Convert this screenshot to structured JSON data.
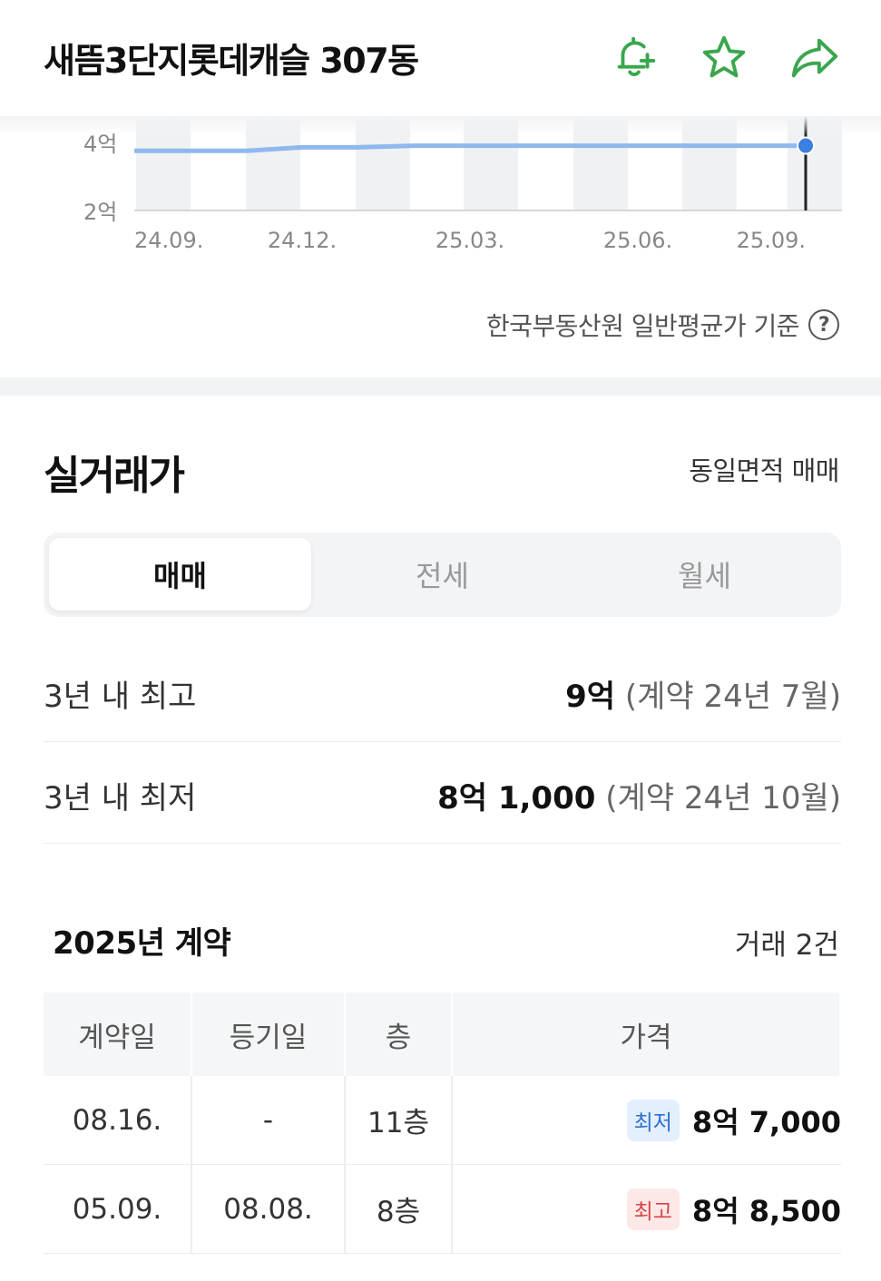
{
  "header": {
    "title": "새뜸3단지롯데캐슬 307동",
    "icon_color": "#3aa64d"
  },
  "chart_data": {
    "type": "line",
    "x": [
      "24.09.",
      "24.10.",
      "24.11.",
      "24.12.",
      "25.01.",
      "25.02.",
      "25.03.",
      "25.04.",
      "25.05.",
      "25.06.",
      "25.07.",
      "25.08.",
      "25.09."
    ],
    "x_tick_labels": [
      "24.09.",
      "24.12.",
      "25.03.",
      "25.06.",
      "25.09."
    ],
    "y_tick_labels": [
      "4억",
      "2억"
    ],
    "series": [
      {
        "values": [
          3.75,
          3.75,
          3.75,
          3.85,
          3.85,
          3.9,
          3.9,
          3.9,
          3.9,
          3.9,
          3.9,
          3.9,
          3.9
        ]
      }
    ],
    "ylim": [
      2,
      4.5
    ],
    "line_color": "#8fb8ee",
    "marker_color": "#3b7fe0",
    "title": "",
    "xlabel": "",
    "ylabel": ""
  },
  "source_note": "한국부동산원 일반평균가 기준",
  "help_symbol": "?",
  "section": {
    "title": "실거래가",
    "link": "동일면적 매매"
  },
  "tabs": [
    "매매",
    "전세",
    "월세"
  ],
  "stats": {
    "high": {
      "label": "3년 내 최고",
      "price": "9억",
      "note": "(계약 24년 7월)"
    },
    "low": {
      "label": "3년 내 최저",
      "price": "8억 1,000",
      "note": "(계약 24년 10월)"
    }
  },
  "year_block": {
    "title": "2025년 계약",
    "count": "거래 2건"
  },
  "table": {
    "headers": [
      "계약일",
      "등기일",
      "층",
      "가격"
    ],
    "rows": [
      {
        "contract": "08.16.",
        "registered": "-",
        "floor": "11층",
        "badge": "최저",
        "price": "8억 7,000"
      },
      {
        "contract": "05.09.",
        "registered": "08.08.",
        "floor": "8층",
        "badge": "최고",
        "price": "8억 8,500"
      }
    ]
  }
}
